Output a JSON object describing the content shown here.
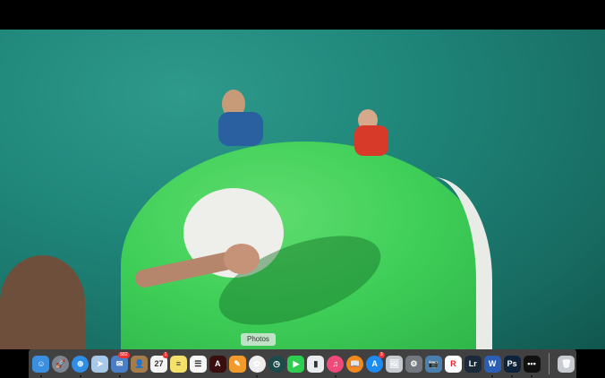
{
  "tooltip": "Photos",
  "dock": {
    "apps": [
      {
        "name": "finder",
        "bg": "#3a8fe0",
        "glyph": "☺",
        "dot": true
      },
      {
        "name": "launchpad",
        "bg": "#7d8590",
        "glyph": "🚀",
        "round": true
      },
      {
        "name": "safari",
        "bg": "#2f8de4",
        "glyph": "⊕",
        "round": true,
        "dot": true
      },
      {
        "name": "maps",
        "bg": "#a8c8e8",
        "glyph": "➤"
      },
      {
        "name": "mail",
        "bg": "#4a7fc8",
        "glyph": "✉",
        "badge": "582",
        "dot": true
      },
      {
        "name": "contacts",
        "bg": "#a67c4b",
        "glyph": "👤"
      },
      {
        "name": "calendar",
        "bg": "#f4f4f4",
        "glyph": "27",
        "badge": "1",
        "dark": true
      },
      {
        "name": "notes",
        "bg": "#f5e16a",
        "glyph": "≡",
        "dark": true
      },
      {
        "name": "reminders",
        "bg": "#f7f7f7",
        "glyph": "☰",
        "dark": true
      },
      {
        "name": "acrobat",
        "bg": "#3a0e0e",
        "glyph": "A"
      },
      {
        "name": "pages",
        "bg": "#f29a2a",
        "glyph": "✎"
      },
      {
        "name": "photos",
        "bg": "#eeeeee",
        "glyph": "✿",
        "round": true,
        "dot": true
      },
      {
        "name": "time-machine",
        "bg": "#1d4a4a",
        "glyph": "◷",
        "round": true
      },
      {
        "name": "facetime",
        "bg": "#2ecc50",
        "glyph": "▶"
      },
      {
        "name": "numbers",
        "bg": "#e9ecef",
        "glyph": "▮",
        "dark": true
      },
      {
        "name": "itunes",
        "bg": "#f04a7a",
        "glyph": "♫",
        "round": true,
        "dot": true
      },
      {
        "name": "ibooks",
        "bg": "#f28a1e",
        "glyph": "📖",
        "round": true
      },
      {
        "name": "app-store",
        "bg": "#1e8bf0",
        "glyph": "A",
        "round": true,
        "badge": "3"
      },
      {
        "name": "preview",
        "bg": "#c8ccd2",
        "glyph": "🖼"
      },
      {
        "name": "system-preferences",
        "bg": "#737880",
        "glyph": "⚙"
      },
      {
        "name": "iphoto",
        "bg": "#4a80b0",
        "glyph": "📷"
      },
      {
        "name": "roblox",
        "bg": "#ffffff",
        "glyph": "R",
        "red": true
      },
      {
        "name": "lightroom",
        "bg": "#1a2a3a",
        "glyph": "Lr"
      },
      {
        "name": "word",
        "bg": "#2b5fb5",
        "glyph": "W",
        "dot": true
      },
      {
        "name": "photoshop",
        "bg": "#0d2438",
        "glyph": "Ps",
        "dot": true
      },
      {
        "name": "gopro-studio",
        "bg": "#111111",
        "glyph": "▪▪▪",
        "dot": true
      }
    ],
    "trash": {
      "name": "trash",
      "bg": "#c8ccd0",
      "glyph": "🗑"
    }
  }
}
